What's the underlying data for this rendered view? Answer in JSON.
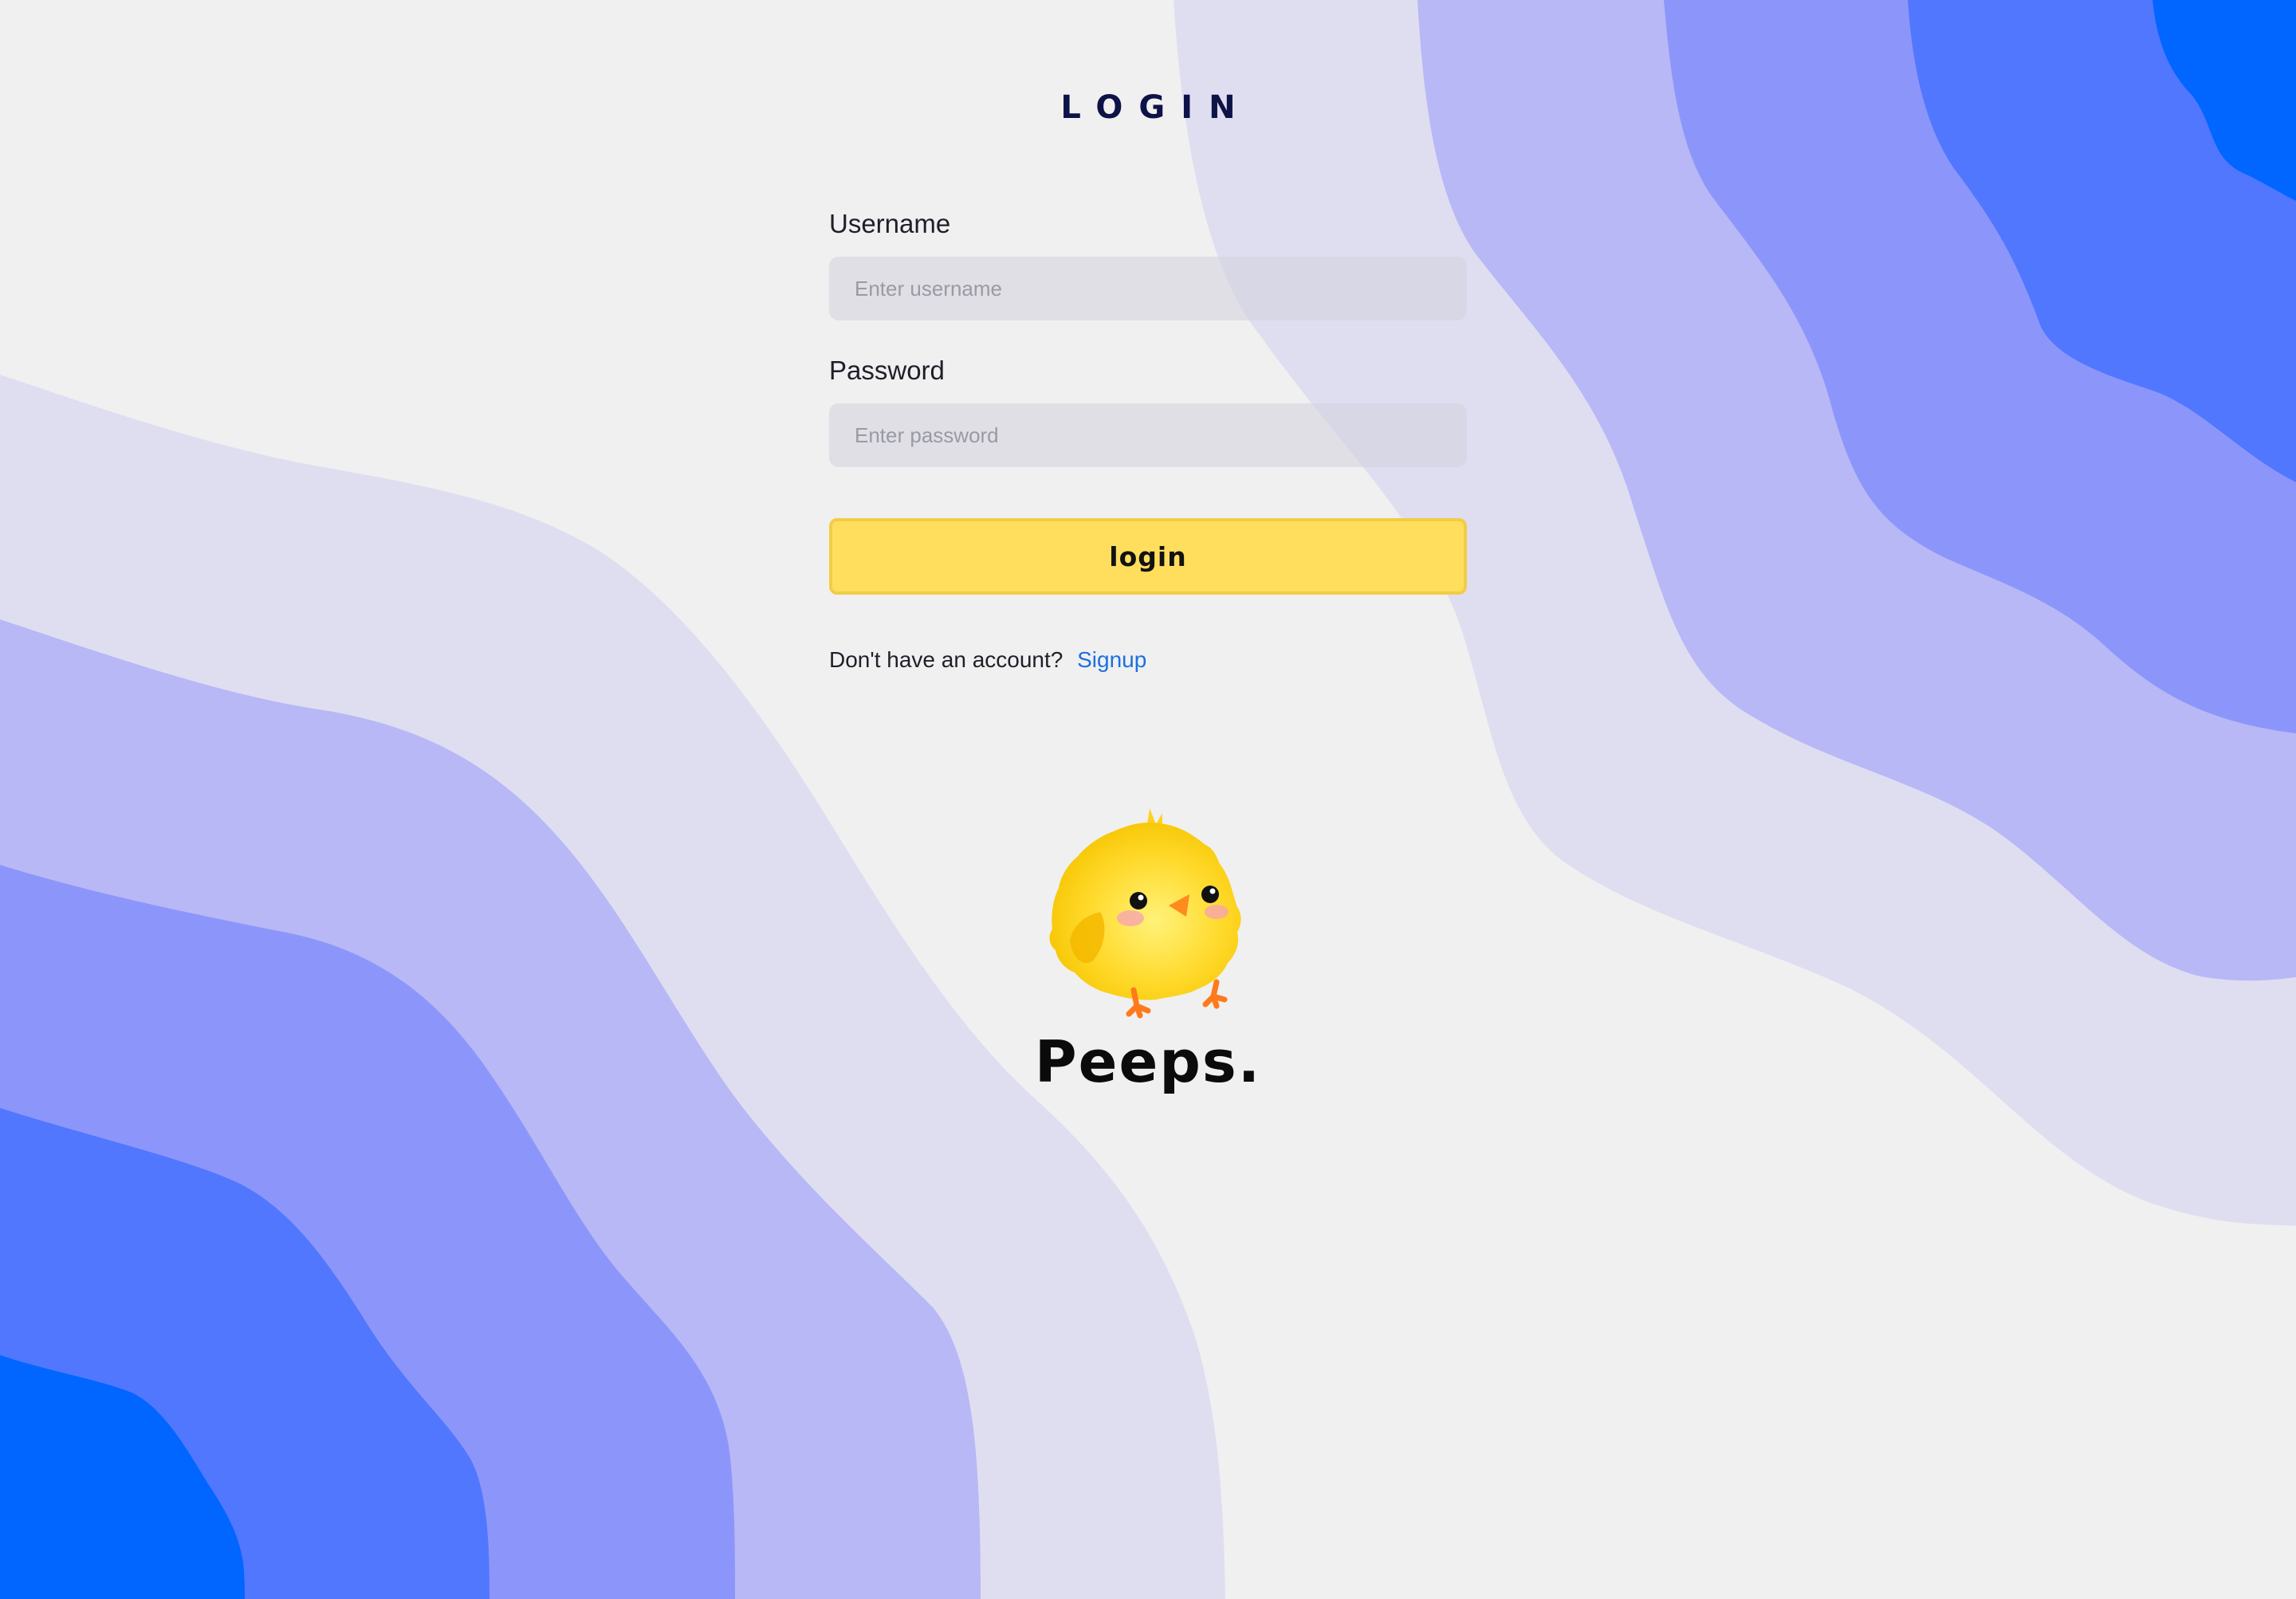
{
  "page": {
    "title": "LOGIN",
    "colors": {
      "background": "#f0f0f0",
      "wave_1": "#dfdef1",
      "wave_2": "#b8b8f6",
      "wave_3": "#8c96fa",
      "wave_4": "#5177ff",
      "wave_5": "#0066ff",
      "title": "#0d1247",
      "button": "#ffde5d",
      "link": "#1d6fe0"
    }
  },
  "form": {
    "username": {
      "label": "Username",
      "placeholder": "Enter username",
      "value": ""
    },
    "password": {
      "label": "Password",
      "placeholder": "Enter password",
      "value": ""
    },
    "submit_label": "login",
    "signup_prompt": "Don't have an account?",
    "signup_link": "Signup"
  },
  "brand": {
    "name": "Peeps.",
    "mascot_icon": "chick-mascot-icon"
  }
}
